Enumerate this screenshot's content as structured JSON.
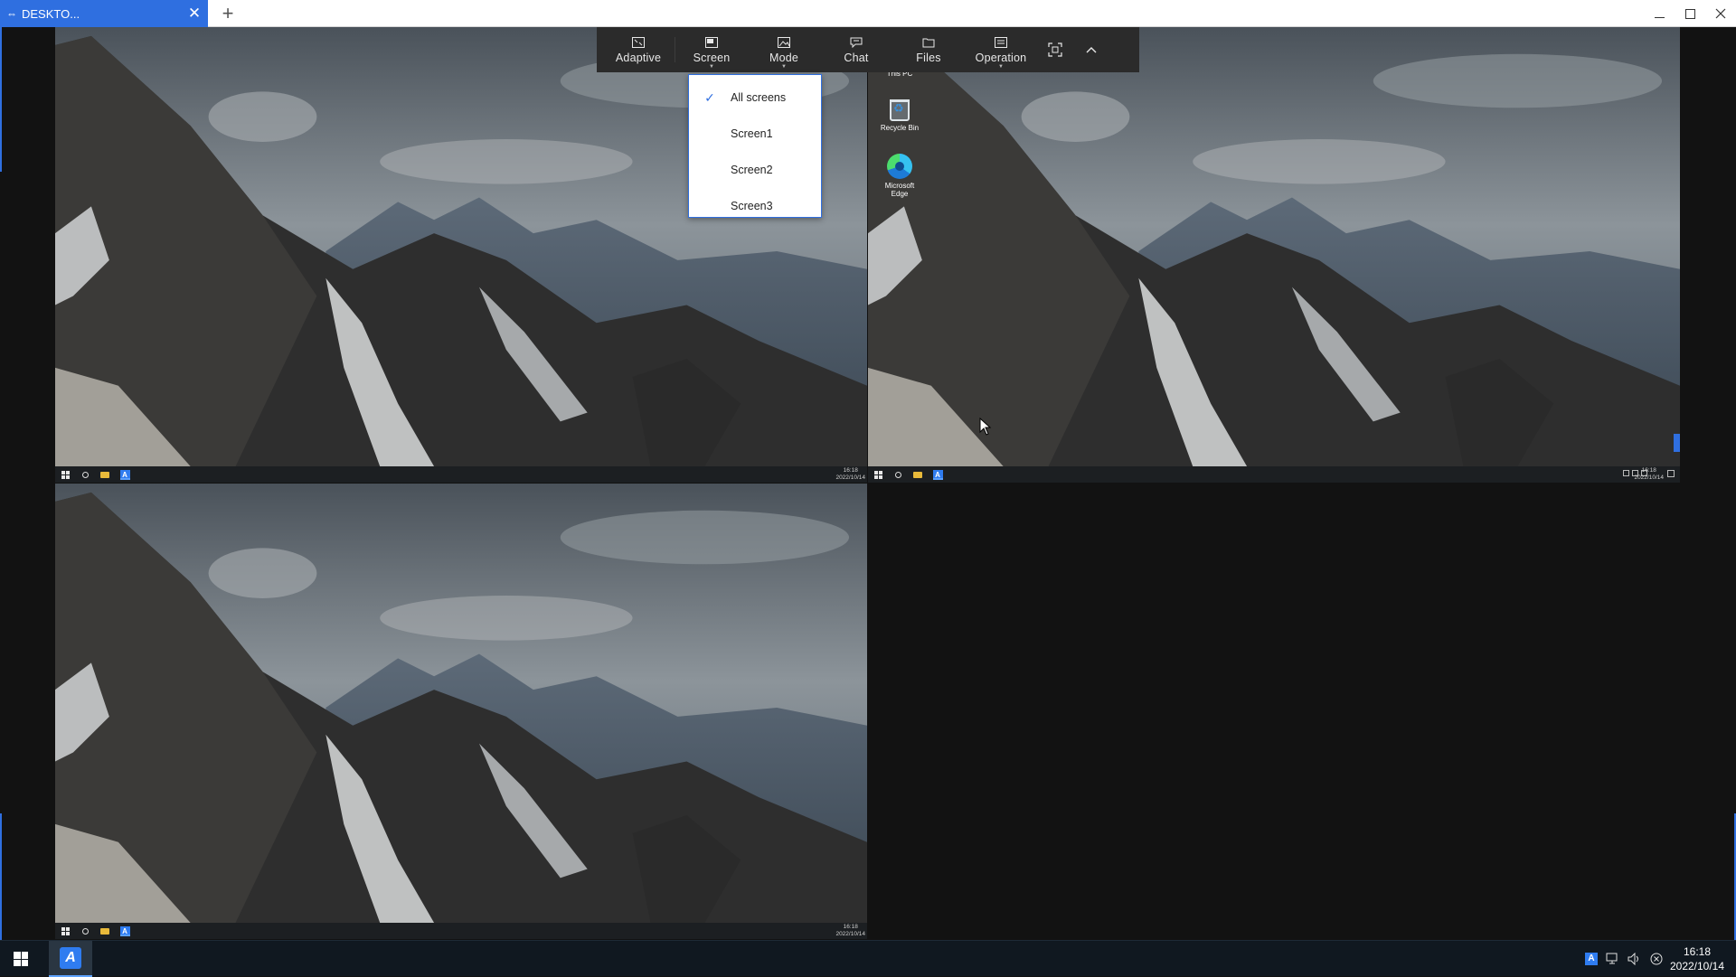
{
  "window": {
    "tab_title": "DESKTO...",
    "tab_close": "✕",
    "new_tab": "+"
  },
  "toolbar": {
    "items": [
      {
        "label": "Adaptive",
        "icon": "adaptive-icon"
      },
      {
        "label": "Screen",
        "icon": "screen-icon"
      },
      {
        "label": "Mode",
        "icon": "image-icon"
      },
      {
        "label": "Chat",
        "icon": "chat-icon"
      },
      {
        "label": "Files",
        "icon": "folder-icon"
      },
      {
        "label": "Operation",
        "icon": "operation-icon"
      }
    ]
  },
  "screen_menu": {
    "selected": "All screens",
    "items": [
      "All screens",
      "Screen1",
      "Screen2",
      "Screen3"
    ]
  },
  "remote": {
    "screen2_icons": {
      "this_pc": "This PC",
      "recycle_bin": "Recycle Bin",
      "edge_line1": "Microsoft",
      "edge_line2": "Edge"
    },
    "mini_time": "16:18",
    "mini_date": "2022/10/14"
  },
  "taskbar": {
    "time": "16:18",
    "date": "2022/10/14"
  },
  "colors": {
    "accent": "#2f6fe0",
    "toolbar_bg": "#2b2b2b",
    "taskbar_bg": "#101820"
  }
}
